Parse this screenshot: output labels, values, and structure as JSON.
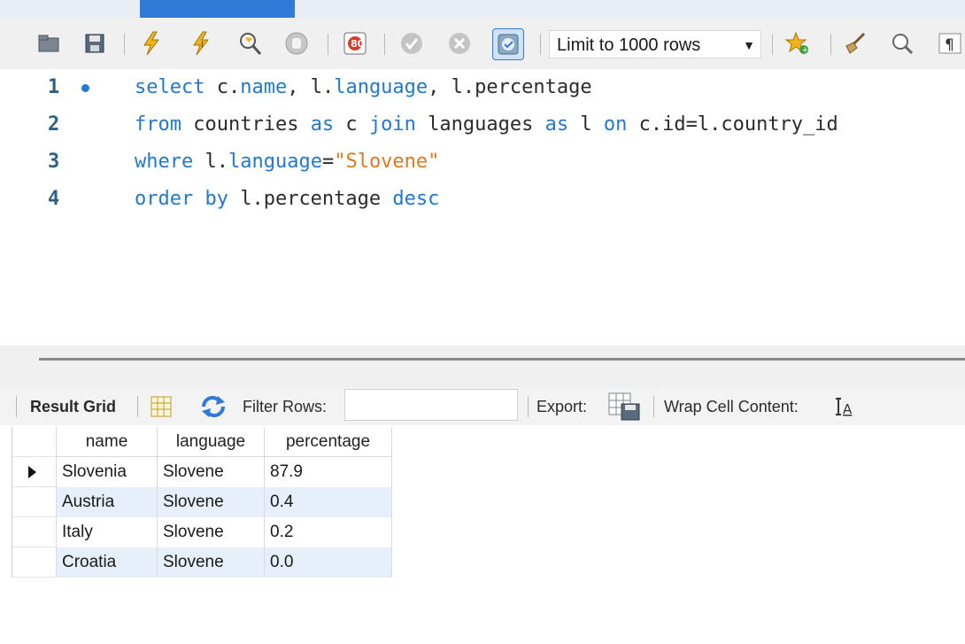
{
  "toolbar": {
    "limit_label": "Limit to 1000 rows",
    "icons": [
      "open-folder-icon",
      "save-icon",
      "execute-icon",
      "execute-current-icon",
      "explain-icon",
      "stop-icon",
      "toggle-error-icon",
      "commit-icon",
      "rollback-icon",
      "autocommit-icon",
      "bookmark-star-icon",
      "beautify-icon",
      "find-icon",
      "invisible-chars-icon"
    ]
  },
  "editor": {
    "lines": [
      {
        "num": "1",
        "tokens": [
          [
            "kw",
            "select"
          ],
          [
            "plain",
            " c."
          ],
          [
            "kw",
            "name"
          ],
          [
            "plain",
            ", l."
          ],
          [
            "kw",
            "language"
          ],
          [
            "plain",
            ", l.percentage"
          ]
        ]
      },
      {
        "num": "2",
        "tokens": [
          [
            "kw",
            "from"
          ],
          [
            "plain",
            " countries "
          ],
          [
            "kw",
            "as"
          ],
          [
            "plain",
            " c "
          ],
          [
            "kw",
            "join"
          ],
          [
            "plain",
            " languages "
          ],
          [
            "kw",
            "as"
          ],
          [
            "plain",
            " l "
          ],
          [
            "kw",
            "on"
          ],
          [
            "plain",
            " c.id=l.country_id"
          ]
        ]
      },
      {
        "num": "3",
        "tokens": [
          [
            "kw",
            "where"
          ],
          [
            "plain",
            " l."
          ],
          [
            "kw",
            "language"
          ],
          [
            "plain",
            "="
          ],
          [
            "str",
            "\"Slovene\""
          ]
        ]
      },
      {
        "num": "4",
        "tokens": [
          [
            "kw",
            "order by"
          ],
          [
            "plain",
            " l.percentage "
          ],
          [
            "kw",
            "desc"
          ]
        ]
      }
    ]
  },
  "results_toolbar": {
    "result_grid_label": "Result Grid",
    "filter_rows_label": "Filter Rows:",
    "filter_value": "",
    "export_label": "Export:",
    "wrap_label": "Wrap Cell Content:"
  },
  "grid": {
    "columns": [
      "name",
      "language",
      "percentage"
    ],
    "rows": [
      [
        "Slovenia",
        "Slovene",
        "87.9"
      ],
      [
        "Austria",
        "Slovene",
        "0.4"
      ],
      [
        "Italy",
        "Slovene",
        "0.2"
      ],
      [
        "Croatia",
        "Slovene",
        "0.0"
      ]
    ],
    "selected_row": 0
  },
  "colors": {
    "keyword": "#1f78d1",
    "string": "#e0791d",
    "line_number": "#2b5f8a",
    "row_alt": "#e6effa"
  }
}
